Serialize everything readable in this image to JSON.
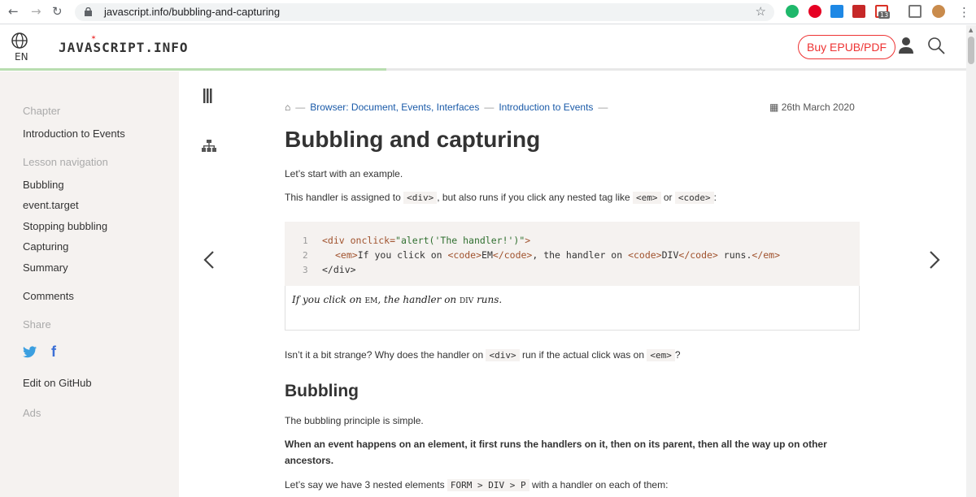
{
  "browser": {
    "url": "javascript.info/bubbling-and-capturing",
    "mail_badge": "13"
  },
  "header": {
    "lang": "EN",
    "logo": "JAVASCRIPT.INFO",
    "epub_button": "Buy EPUB/PDF",
    "reading_progress": 0.4
  },
  "sidebar": {
    "chapter_label": "Chapter",
    "chapter_link": "Introduction to Events",
    "lesson_nav_label": "Lesson navigation",
    "lesson_items": [
      "Bubbling",
      "event.target",
      "Stopping bubbling",
      "Capturing",
      "Summary"
    ],
    "comments": "Comments",
    "share_label": "Share",
    "edit_github": "Edit on GitHub",
    "ads_label": "Ads"
  },
  "breadcrumbs": {
    "items": [
      "Browser: Document, Events, Interfaces",
      "Introduction to Events"
    ]
  },
  "article": {
    "date": "26th March 2020",
    "title": "Bubbling and capturing",
    "p1": "Let’s start with an example.",
    "p2_a": "This handler is assigned to ",
    "p2_code1": "<div>",
    "p2_b": ", but also runs if you click any nested tag like ",
    "p2_code2": "<em>",
    "p2_c": " or ",
    "p2_code3": "<code>",
    "p2_d": ":",
    "code_line_numbers": [
      "1",
      "2",
      "3"
    ],
    "code_line1_tag": "<div ",
    "code_line1_attr": "onclick=",
    "code_line1_str": "\"alert('The handler!')\"",
    "code_line1_end": ">",
    "code_line2_a": "<em>",
    "code_line2_b": "If you click on ",
    "code_line2_c": "<code>",
    "code_line2_d": "EM",
    "code_line2_e": "</code>",
    "code_line2_f": ", the handler on ",
    "code_line2_g": "<code>",
    "code_line2_h": "DIV",
    "code_line2_i": "</code>",
    "code_line2_j": " runs.",
    "code_line2_k": "</em>",
    "code_line3": "</div>",
    "result_a": "If you click on ",
    "result_em": "EM",
    "result_b": ", the handler on ",
    "result_div": "DIV",
    "result_c": " runs.",
    "p3_a": "Isn’t it a bit strange? Why does the handler on ",
    "p3_code1": "<div>",
    "p3_b": " run if the actual click was on ",
    "p3_code2": "<em>",
    "p3_c": "?",
    "h2": "Bubbling",
    "p4": "The bubbling principle is simple.",
    "p5_line1": "When an event happens on an element, it first runs the handlers on it, then on its parent, then all the way up on other",
    "p5_line2": "ancestors.",
    "p6_a": "Let’s say we have 3 nested elements ",
    "p6_code": "FORM > DIV > P",
    "p6_b": " with a handler on each of them:"
  }
}
